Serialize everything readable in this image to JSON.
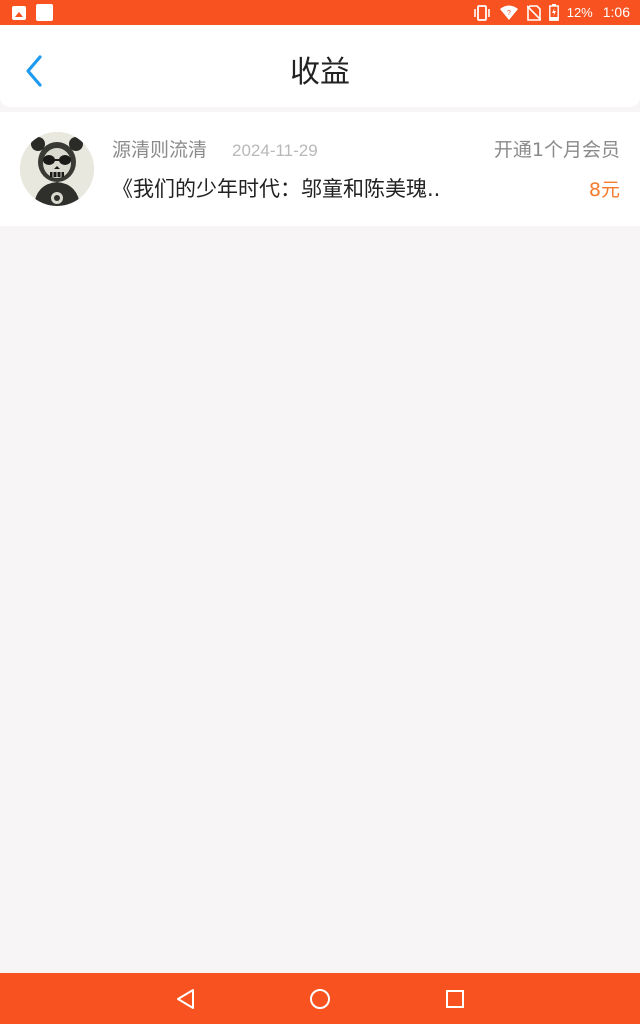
{
  "status_bar": {
    "battery": "12%",
    "time": "1:06",
    "icons": [
      "image-icon",
      "app-icon",
      "vibrate-icon",
      "wifi-icon",
      "no-sim-icon",
      "battery-charging-icon"
    ]
  },
  "header": {
    "title": "收益",
    "back_icon": "chevron-left-icon"
  },
  "earnings": [
    {
      "user": "源清则流清",
      "date": "2024-11-29",
      "action": "开通1个月会员",
      "book": "《我们的少年时代：邬童和陈美瑰..",
      "amount": "8元"
    }
  ],
  "nav_bar": {
    "icons": [
      "back-triangle-icon",
      "home-circle-icon",
      "recents-square-icon"
    ]
  },
  "colors": {
    "accent": "#f75220",
    "back_arrow": "#1e9bf0",
    "amount": "#f57a2c",
    "background": "#f7f5f6"
  }
}
